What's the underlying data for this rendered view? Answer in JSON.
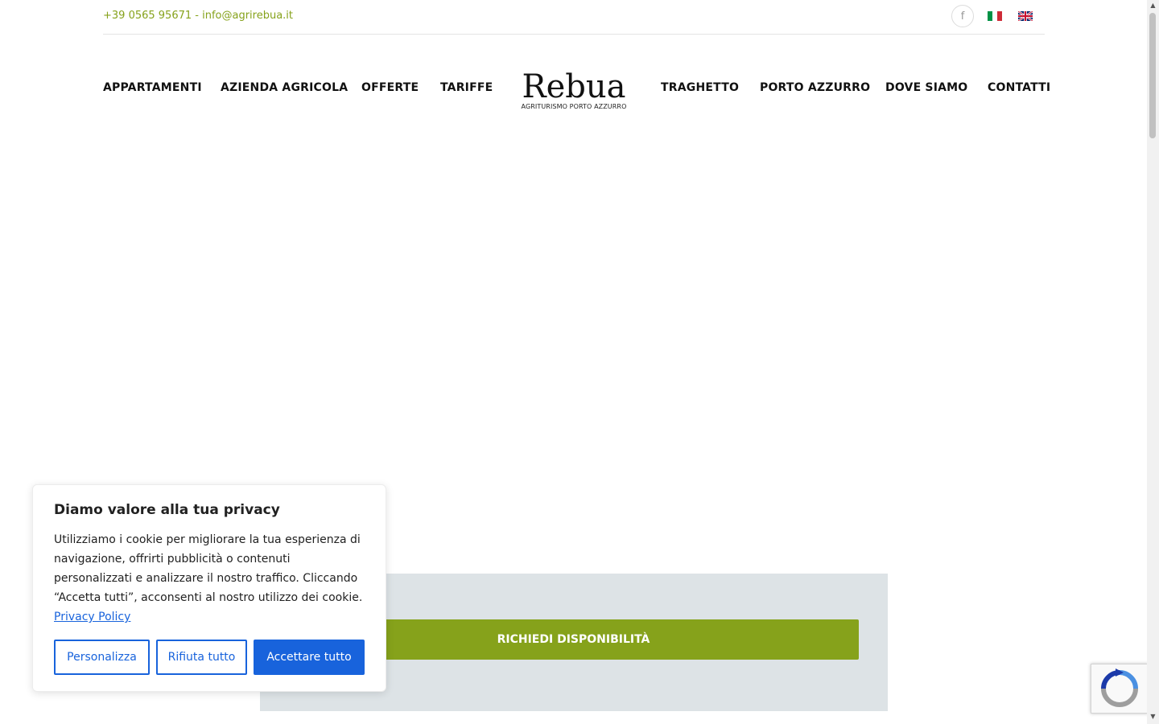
{
  "topbar": {
    "contact": "+39 0565 95671 - info@agrirebua.it",
    "facebook_icon": "f"
  },
  "nav": {
    "left": [
      "APPARTAMENTI",
      "AZIENDA AGRICOLA",
      "OFFERTE",
      "TARIFFE"
    ],
    "right": [
      "TRAGHETTO",
      "PORTO AZZURRO",
      "DOVE SIAMO",
      "CONTATTI"
    ]
  },
  "logo": {
    "name": "Rebua",
    "subtitle": "AGRITURISMO PORTO AZZURRO"
  },
  "booking": {
    "button_label": "RICHIEDI DISPONIBILITÀ"
  },
  "cookie": {
    "title": "Diamo valore alla tua privacy",
    "text": "Utilizziamo i cookie per migliorare la tua esperienza di navigazione, offrirti pubblicità o contenuti personalizzati e analizzare il nostro traffico. Cliccando “Accetta tutti”, acconsenti al nostro utilizzo dei cookie.",
    "link": "Privacy Policy",
    "customize": "Personalizza",
    "reject": "Rifiuta tutto",
    "accept": "Accettare tutto"
  },
  "colors": {
    "accent_green": "#86a21b",
    "cookie_blue": "#1863dc",
    "panel_bg": "#dde3e6"
  }
}
